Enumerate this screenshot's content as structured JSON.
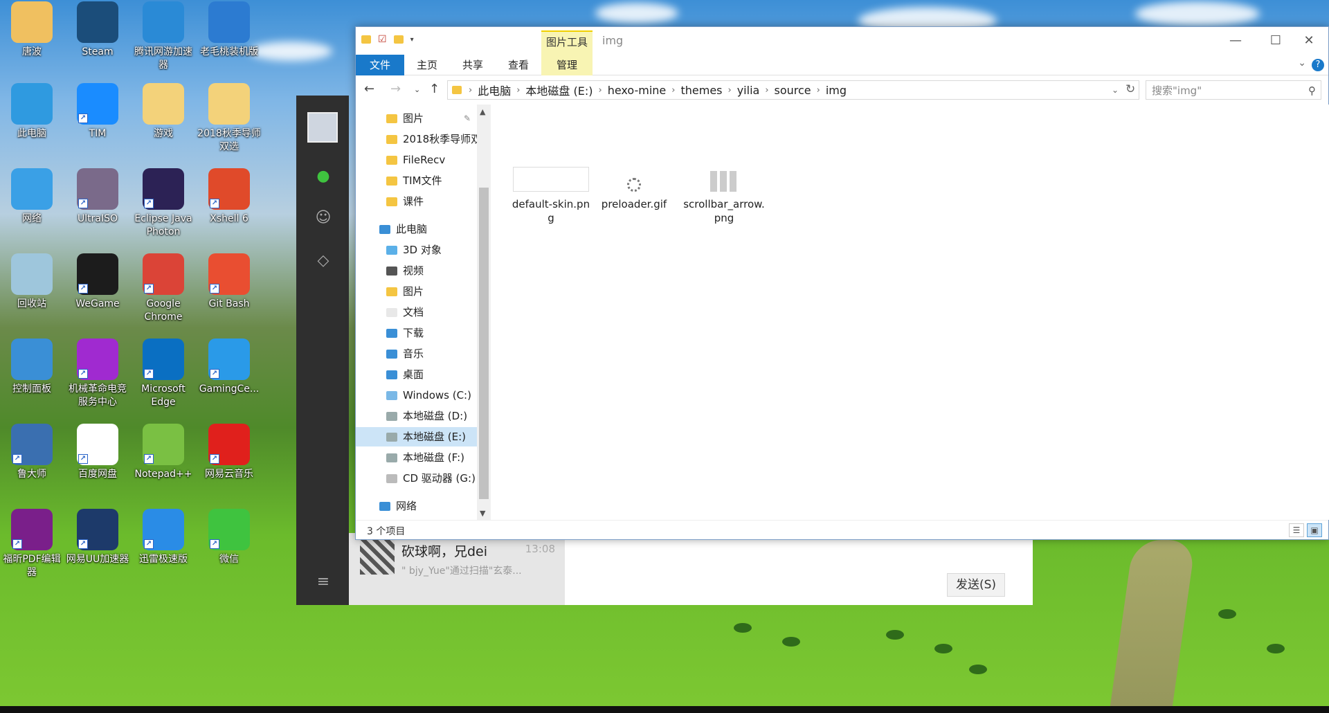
{
  "desktop": {
    "icons": [
      {
        "label": "唐波",
        "icon": "user-folder-icon",
        "color": "#f0c060"
      },
      {
        "label": "Steam",
        "icon": "steam-icon",
        "color": "#1b4d7a"
      },
      {
        "label": "腾讯网游加速器",
        "icon": "tencent-accelerator-icon",
        "color": "#2a8ad6"
      },
      {
        "label": "老毛桃装机版",
        "icon": "laomaotao-icon",
        "color": "#2c7bd1"
      },
      {
        "label": "此电脑",
        "icon": "computer-icon",
        "color": "#2f9ae0"
      },
      {
        "label": "TIM",
        "icon": "tim-icon",
        "color": "#1a8cff"
      },
      {
        "label": "游戏",
        "icon": "folder-icon",
        "color": "#f3d27a"
      },
      {
        "label": "2018秋季导师双选",
        "icon": "folder-icon",
        "color": "#f3d27a"
      },
      {
        "label": "网络",
        "icon": "network-icon",
        "color": "#3aa0e6"
      },
      {
        "label": "UltraISO",
        "icon": "disc-icon",
        "color": "#7a6a8a"
      },
      {
        "label": "Eclipse Java Photon",
        "icon": "eclipse-icon",
        "color": "#2c2255"
      },
      {
        "label": "Xshell 6",
        "icon": "xshell-icon",
        "color": "#e04a2a"
      },
      {
        "label": "回收站",
        "icon": "recycle-bin-icon",
        "color": "#9ec6dc"
      },
      {
        "label": "WeGame",
        "icon": "wegame-icon",
        "color": "#1c1c1c"
      },
      {
        "label": "Google Chrome",
        "icon": "chrome-icon",
        "color": "#db4437"
      },
      {
        "label": "Git Bash",
        "icon": "git-bash-icon",
        "color": "#e94e31"
      },
      {
        "label": "控制面板",
        "icon": "control-panel-icon",
        "color": "#3a8fd6"
      },
      {
        "label": "机械革命电竞服务中心",
        "icon": "mechrevo-icon",
        "color": "#a02ad0"
      },
      {
        "label": "Microsoft Edge",
        "icon": "edge-icon",
        "color": "#0a6fc2"
      },
      {
        "label": "GamingCe...",
        "icon": "gaming-center-icon",
        "color": "#2a9ae8"
      },
      {
        "label": "鲁大师",
        "icon": "ludashi-icon",
        "color": "#3a6fb0"
      },
      {
        "label": "百度网盘",
        "icon": "baidu-netdisk-icon",
        "color": "#ffffff"
      },
      {
        "label": "Notepad++",
        "icon": "notepad-plus-icon",
        "color": "#7ac043"
      },
      {
        "label": "网易云音乐",
        "icon": "netease-music-icon",
        "color": "#e0201c"
      },
      {
        "label": "福昕PDF编辑器",
        "icon": "foxit-pdf-icon",
        "color": "#7a1f8a"
      },
      {
        "label": "网易UU加速器",
        "icon": "uu-accelerator-icon",
        "color": "#1d3a6a"
      },
      {
        "label": "迅雷极速版",
        "icon": "xunlei-icon",
        "color": "#2a8ce6"
      },
      {
        "label": "微信",
        "icon": "wechat-icon",
        "color": "#3fc33f"
      }
    ]
  },
  "chat": {
    "conversation_title": "砍球啊，兄dei",
    "conversation_time": "13:08",
    "conversation_preview": "\" bjy_Yue\"通过扫描\"玄泰...",
    "send_label": "发送(S)"
  },
  "explorer": {
    "window_title": "img",
    "context_tab": "图片工具",
    "ribbon_tabs": [
      "文件",
      "主页",
      "共享",
      "查看",
      "管理"
    ],
    "breadcrumb": [
      "此电脑",
      "本地磁盘 (E:)",
      "hexo-mine",
      "themes",
      "yilia",
      "source",
      "img"
    ],
    "search_placeholder": "搜索\"img\"",
    "nav_pane": [
      {
        "label": "图片",
        "icon": "pictures-folder-icon",
        "pinned": true
      },
      {
        "label": "2018秋季导师双",
        "icon": "folder-icon"
      },
      {
        "label": "FileRecv",
        "icon": "folder-icon"
      },
      {
        "label": "TIM文件",
        "icon": "folder-icon"
      },
      {
        "label": "课件",
        "icon": "folder-icon"
      },
      {
        "label": "此电脑",
        "icon": "computer-icon"
      },
      {
        "label": "3D 对象",
        "icon": "3d-objects-icon"
      },
      {
        "label": "视频",
        "icon": "videos-icon"
      },
      {
        "label": "图片",
        "icon": "pictures-folder-icon"
      },
      {
        "label": "文档",
        "icon": "documents-icon"
      },
      {
        "label": "下载",
        "icon": "downloads-icon"
      },
      {
        "label": "音乐",
        "icon": "music-icon"
      },
      {
        "label": "桌面",
        "icon": "desktop-icon"
      },
      {
        "label": "Windows (C:)",
        "icon": "windows-drive-icon"
      },
      {
        "label": "本地磁盘 (D:)",
        "icon": "drive-icon"
      },
      {
        "label": "本地磁盘 (E:)",
        "icon": "drive-icon",
        "selected": true
      },
      {
        "label": "本地磁盘 (F:)",
        "icon": "drive-icon"
      },
      {
        "label": "CD 驱动器 (G:)",
        "icon": "cd-drive-icon"
      },
      {
        "label": "网络",
        "icon": "network-icon"
      }
    ],
    "files": [
      {
        "name": "default-skin.png",
        "icon": "image-thumbnail-icon"
      },
      {
        "name": "preloader.gif",
        "icon": "gif-thumbnail-icon"
      },
      {
        "name": "scrollbar_arrow.png",
        "icon": "arrows-thumbnail-icon"
      }
    ],
    "status": "3 个项目"
  },
  "colors": {
    "accent": "#1979ca",
    "context_tab": "#f8f4b3",
    "selection": "#cce4f7"
  }
}
